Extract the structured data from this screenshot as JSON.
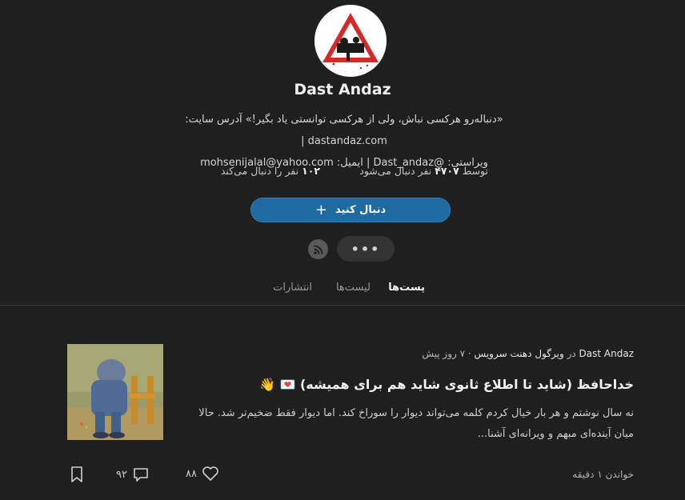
{
  "profile": {
    "name": "Dast Andaz",
    "bio_line1": "«دنباله‌رو هرکسی نباش، ولی از هرکسی توانستی یاد بگیر!» آدرس سایت: dastandaz.com |",
    "bio_line2": "ویراستی: @Dast_andaz | ایمیل: mohsenijalal@yahoo.com",
    "followers_prefix": "توسط",
    "followers_count": "۴۷۰۷",
    "followers_suffix": "نفر دنبال می‌شود",
    "following_count": "۱۰۲",
    "following_suffix": "نفر را دنبال می‌کند",
    "follow_label": "دنبال کنید",
    "more_label": "•••"
  },
  "tabs": [
    {
      "label": "پست‌ها",
      "active": true
    },
    {
      "label": "لیست‌ها",
      "active": false
    },
    {
      "label": "انتشارات",
      "active": false
    }
  ],
  "post": {
    "author": "Dast Andaz",
    "in_word": "در",
    "publication": "ویرگول دهنت سرویس",
    "separator": "·",
    "time": "۷ روز پیش",
    "title": "خداحافظ (شاید تا اطلاع ثانوی شاید هم برای همیشه)",
    "title_emojis": "💌 👋",
    "excerpt": "نه سال نوشتم و هر بار خیال کردم کلمه می‌تواند دیوار را سوراخ کند. اما دیوار فقط ضخیم‌تر شد. حالا میان آینده‌ای مبهم و ویرانه‌ای آشنا...",
    "read_time": "خواندن ۱ دقیقه",
    "likes": "۸۸",
    "comments": "۹۲"
  },
  "colors": {
    "background": "#1f1f1f",
    "accent": "#1f6aa1",
    "logo_red": "#d42a2a"
  },
  "icons": [
    "plus-icon",
    "rss-icon",
    "heart-icon",
    "comment-icon",
    "bookmark-icon"
  ]
}
